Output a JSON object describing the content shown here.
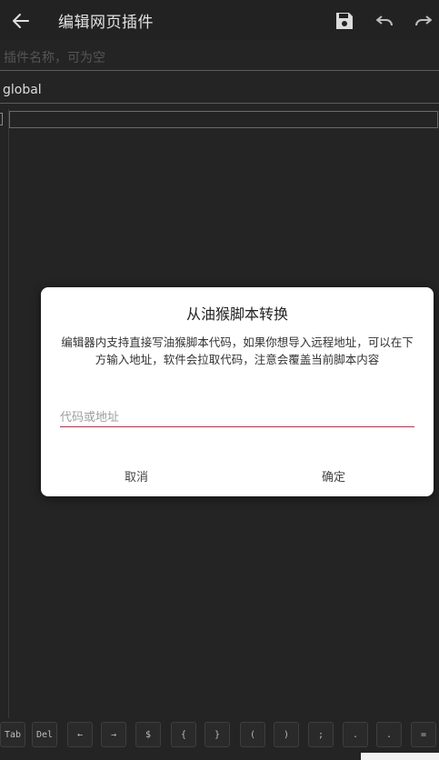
{
  "appbar": {
    "title": "编辑网页插件",
    "icons": [
      "back-arrow-icon",
      "save-icon",
      "undo-icon",
      "redo-icon"
    ]
  },
  "form": {
    "name_placeholder": "插件名称，可为空",
    "scope_value": "global"
  },
  "dialog": {
    "title": "从油猴脚本转换",
    "message": "编辑器内支持直接写油猴脚本代码，如果你想导入远程地址，可以在下方输入地址，软件会拉取代码，注意会覆盖当前脚本内容",
    "input_placeholder": "代码或地址",
    "cancel_label": "取消",
    "confirm_label": "确定"
  },
  "keys": [
    "Tab",
    "Del",
    "←",
    "→",
    "$",
    "{",
    "}",
    "(",
    ")",
    ";",
    ".",
    ".",
    "="
  ],
  "colors": {
    "background": "#242424",
    "dialog": "#ffffff",
    "accent_underline": "#c8264e"
  }
}
